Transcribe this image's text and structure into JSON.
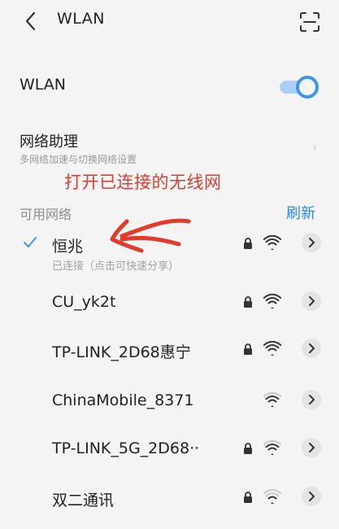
{
  "header": {
    "title": "WLAN",
    "back_icon": "chevron-left-icon",
    "scan_icon": "scan-icon"
  },
  "wlan": {
    "label": "WLAN",
    "enabled": true,
    "toggle_color": "#3f97ec"
  },
  "assistant": {
    "title": "网络助理",
    "subtitle": "多网络加速与切换网络设置",
    "chevron": "›"
  },
  "annotation": {
    "text": "打开已连接的无线网",
    "color": "#e33a2c"
  },
  "available": {
    "label": "可用网络",
    "refresh_label": "刷新",
    "accent": "#2f86df"
  },
  "networks": [
    {
      "name": "恒兆",
      "status": "已连接（点击可快速分享）",
      "connected": true,
      "locked": true,
      "signal": 3
    },
    {
      "name": "CU_yk2t",
      "status": "",
      "connected": false,
      "locked": true,
      "signal": 3
    },
    {
      "name": "TP-LINK_2D68惠宁",
      "status": "",
      "connected": false,
      "locked": true,
      "signal": 3
    },
    {
      "name": "ChinaMobile_8371",
      "status": "",
      "connected": false,
      "locked": false,
      "signal": 2
    },
    {
      "name": "TP-LINK_5G_2D68··",
      "status": "",
      "connected": false,
      "locked": true,
      "signal": 2
    },
    {
      "name": "双二通讯",
      "status": "",
      "connected": false,
      "locked": true,
      "signal": 1
    }
  ]
}
